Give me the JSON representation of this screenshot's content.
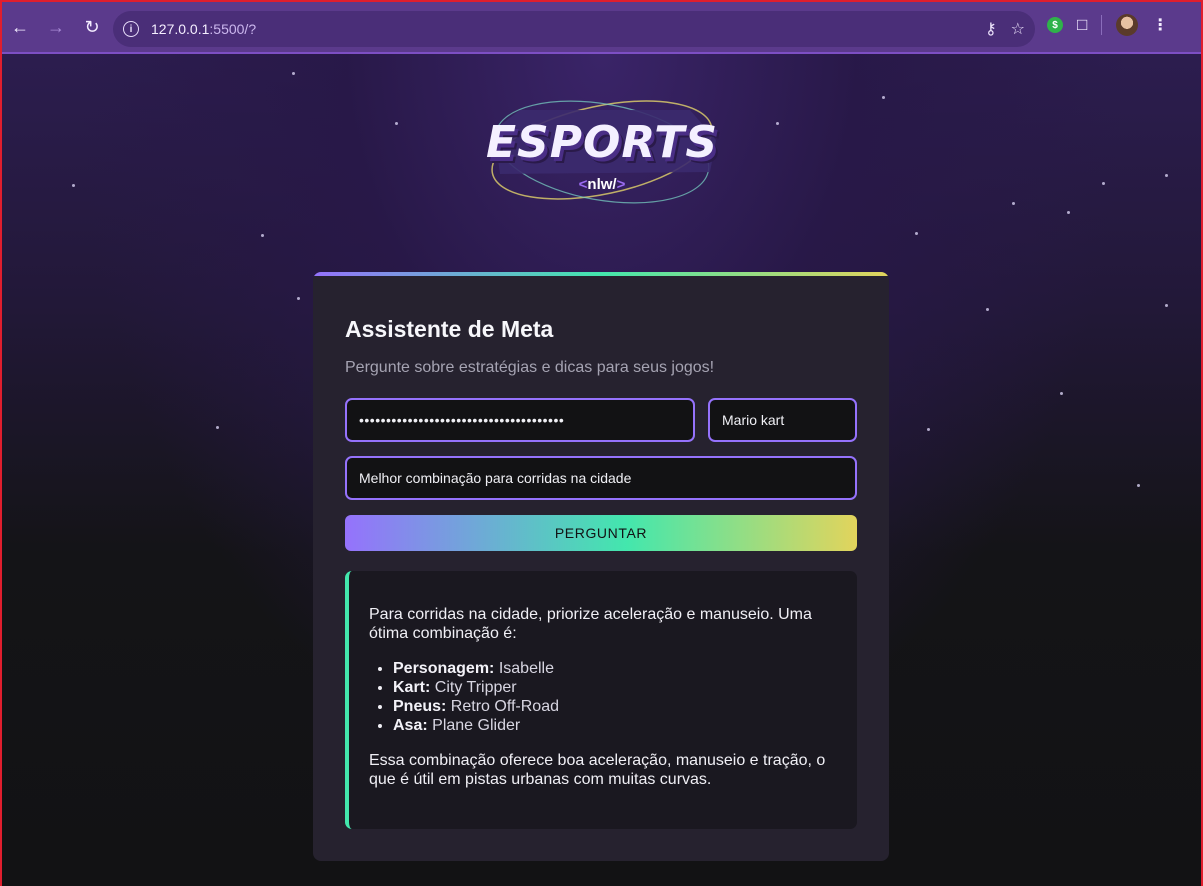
{
  "browser": {
    "url_host": "127.0.0.1",
    "url_rest": ":5500/?",
    "ext_badge": "$"
  },
  "logo": {
    "title": "ESPORTS",
    "sub_open": "<",
    "sub_text": "nlw/",
    "sub_close": ">"
  },
  "card": {
    "title": "Assistente de Meta",
    "subtitle": "Pergunte sobre estratégias e dicas para seus jogos!",
    "api_key_masked": "••••••••••••••••••••••••••••••••••••••",
    "game_value": "Mario kart",
    "question_value": "Melhor combinação para corridas na cidade",
    "ask_label": "PERGUNTAR"
  },
  "answer": {
    "intro": "Para corridas na cidade, priorize aceleração e manuseio. Uma ótima combinação é:",
    "items": [
      {
        "label": "Personagem:",
        "value": "Isabelle"
      },
      {
        "label": "Kart:",
        "value": "City Tripper"
      },
      {
        "label": "Pneus:",
        "value": "Retro Off-Road"
      },
      {
        "label": "Asa:",
        "value": "Plane Glider"
      }
    ],
    "outro": "Essa combinação oferece boa aceleração, manuseio e tração, o que é útil em pistas urbanas com muitas curvas."
  },
  "colors": {
    "accent_purple": "#9572fc",
    "accent_green": "#43e7ad",
    "accent_yellow": "#e2d45c",
    "chrome": "#5b3a8c"
  }
}
